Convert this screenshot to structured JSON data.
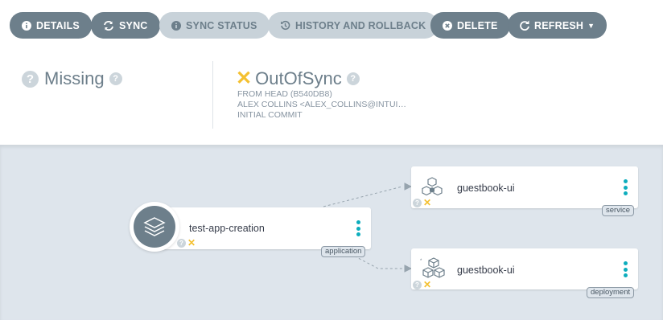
{
  "toolbar": {
    "details": "DETAILS",
    "sync": "SYNC",
    "sync_status": "SYNC STATUS",
    "history": "HISTORY AND ROLLBACK",
    "delete": "DELETE",
    "refresh": "REFRESH"
  },
  "status": {
    "health_label": "Missing",
    "sync_label": "OutOfSync",
    "sync_from": "FROM HEAD (B540DB8)",
    "sync_author": "ALEX COLLINS <ALEX_COLLINS@INTUI…",
    "sync_message": "INITIAL COMMIT"
  },
  "graph": {
    "app_node": {
      "name": "test-app-creation",
      "kind": "application"
    },
    "resources": [
      {
        "name": "guestbook-ui",
        "kind": "service",
        "icon": "service-icon"
      },
      {
        "name": "guestbook-ui",
        "kind": "deployment",
        "icon": "deployment-icon"
      }
    ]
  },
  "colors": {
    "button_dark": "#6d7f8b",
    "button_disabled": "#c8d2d9",
    "out_of_sync": "#f4c030",
    "kebab": "#0dadbd",
    "graph_bg": "#dee5ec"
  }
}
